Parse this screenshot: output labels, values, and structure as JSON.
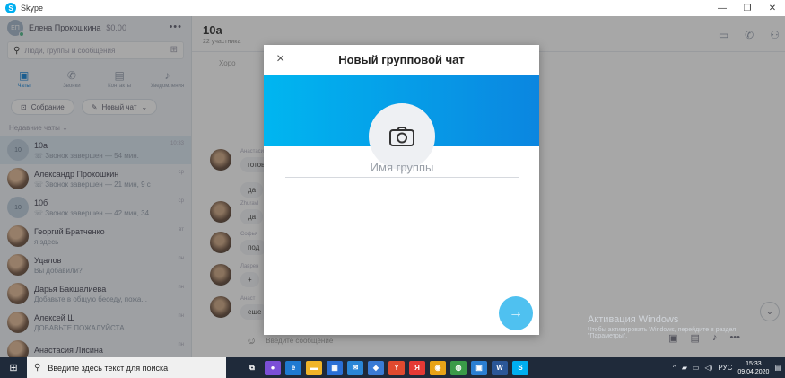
{
  "window": {
    "title": "Skype",
    "logo_letter": "S"
  },
  "profile": {
    "initials": "ЕП",
    "name": "Елена Прокошкина",
    "credit": "$0.00",
    "more": "•••"
  },
  "search": {
    "placeholder": "Люди, группы и сообщения"
  },
  "nav": [
    {
      "label": "Чаты",
      "icon": "chat-icon",
      "glyph": "▣",
      "active": true
    },
    {
      "label": "Звонки",
      "icon": "phone-icon",
      "glyph": "✆",
      "active": false
    },
    {
      "label": "Контакты",
      "icon": "contacts-icon",
      "glyph": "▤",
      "active": false
    },
    {
      "label": "Уведомления",
      "icon": "bell-icon",
      "glyph": "♪",
      "active": false
    }
  ],
  "actions": {
    "meeting": "Собрание",
    "new_chat": "Новый чат"
  },
  "section_label": "Недавние чаты",
  "chats": [
    {
      "name": "10а",
      "preview": "Звонок завершен — 54 мин.",
      "time": "10:33",
      "initials": "10",
      "type": "group",
      "active": true
    },
    {
      "name": "Александр Прокошкин",
      "preview": "Звонок завершен — 21 мин, 9 с",
      "time": "ср",
      "type": "photo",
      "active": false
    },
    {
      "name": "10б",
      "preview": "Звонок завершен — 42 мин, 34",
      "time": "ср",
      "initials": "10",
      "type": "group",
      "active": false
    },
    {
      "name": "Георгий Братченко",
      "preview": "я здесь",
      "time": "вт",
      "type": "photo",
      "active": false
    },
    {
      "name": "Удалов",
      "preview": "Вы добавили?",
      "time": "пн",
      "type": "photo",
      "active": false
    },
    {
      "name": "Дарья Бакшалиева",
      "preview": "Добавьте в общую беседу, пожа...",
      "time": "пн",
      "type": "photo",
      "active": false
    },
    {
      "name": "Алексей Ш",
      "preview": "ДОБАВЬТЕ ПОЖАЛУЙСТА",
      "time": "пн",
      "type": "photo",
      "active": false
    },
    {
      "name": "Анастасия Лисина",
      "preview": "",
      "time": "пн",
      "type": "photo",
      "active": false
    }
  ],
  "conversation": {
    "title": "10а",
    "participants": "22 участника",
    "messages": [
      {
        "author": "Анастасия",
        "text": "готов"
      },
      {
        "author": "",
        "text": "да"
      },
      {
        "author": "Zhuravl",
        "text": "да"
      },
      {
        "author": "Софья",
        "text": "под"
      },
      {
        "author": "Лаврен",
        "text": "+"
      },
      {
        "author": "Анаст",
        "text": "еще"
      }
    ],
    "composer_placeholder": "Введите сообщение",
    "top_fragment": "Хоро"
  },
  "activation": {
    "title": "Активация Windows",
    "text": "Чтобы активировать Windows, перейдите в раздел \"Параметры\"."
  },
  "modal": {
    "title": "Новый групповой чат",
    "name_placeholder": "Имя группы",
    "close_glyph": "×",
    "next_glyph": "→"
  },
  "taskbar": {
    "search_placeholder": "Введите здесь текст для поиска",
    "language": "РУС",
    "time": "15:33",
    "date": "09.04.2020",
    "apps": [
      {
        "name": "task-view-icon",
        "glyph": "⧉",
        "color": "#1f2a3a"
      },
      {
        "name": "app-purple-icon",
        "glyph": "●",
        "color": "#7b4fd6"
      },
      {
        "name": "edge-icon",
        "glyph": "e",
        "color": "#1f7ad1"
      },
      {
        "name": "explorer-icon",
        "glyph": "▬",
        "color": "#f0b429"
      },
      {
        "name": "store-icon",
        "glyph": "▦",
        "color": "#2a6fd6"
      },
      {
        "name": "mail-icon",
        "glyph": "✉",
        "color": "#2a86d6"
      },
      {
        "name": "photos-icon",
        "glyph": "◆",
        "color": "#3a7bd5"
      },
      {
        "name": "yandex-browser-icon",
        "glyph": "Y",
        "color": "#e04a2f"
      },
      {
        "name": "yandex-icon",
        "glyph": "Я",
        "color": "#e53935"
      },
      {
        "name": "chrome-icon",
        "glyph": "◉",
        "color": "#e8a317"
      },
      {
        "name": "app-green-icon",
        "glyph": "◍",
        "color": "#3a9a48"
      },
      {
        "name": "image-viewer-icon",
        "glyph": "▣",
        "color": "#2b7fd2"
      },
      {
        "name": "word-icon",
        "glyph": "W",
        "color": "#2b5797"
      },
      {
        "name": "skype-icon",
        "glyph": "S",
        "color": "#00aff0"
      }
    ]
  }
}
